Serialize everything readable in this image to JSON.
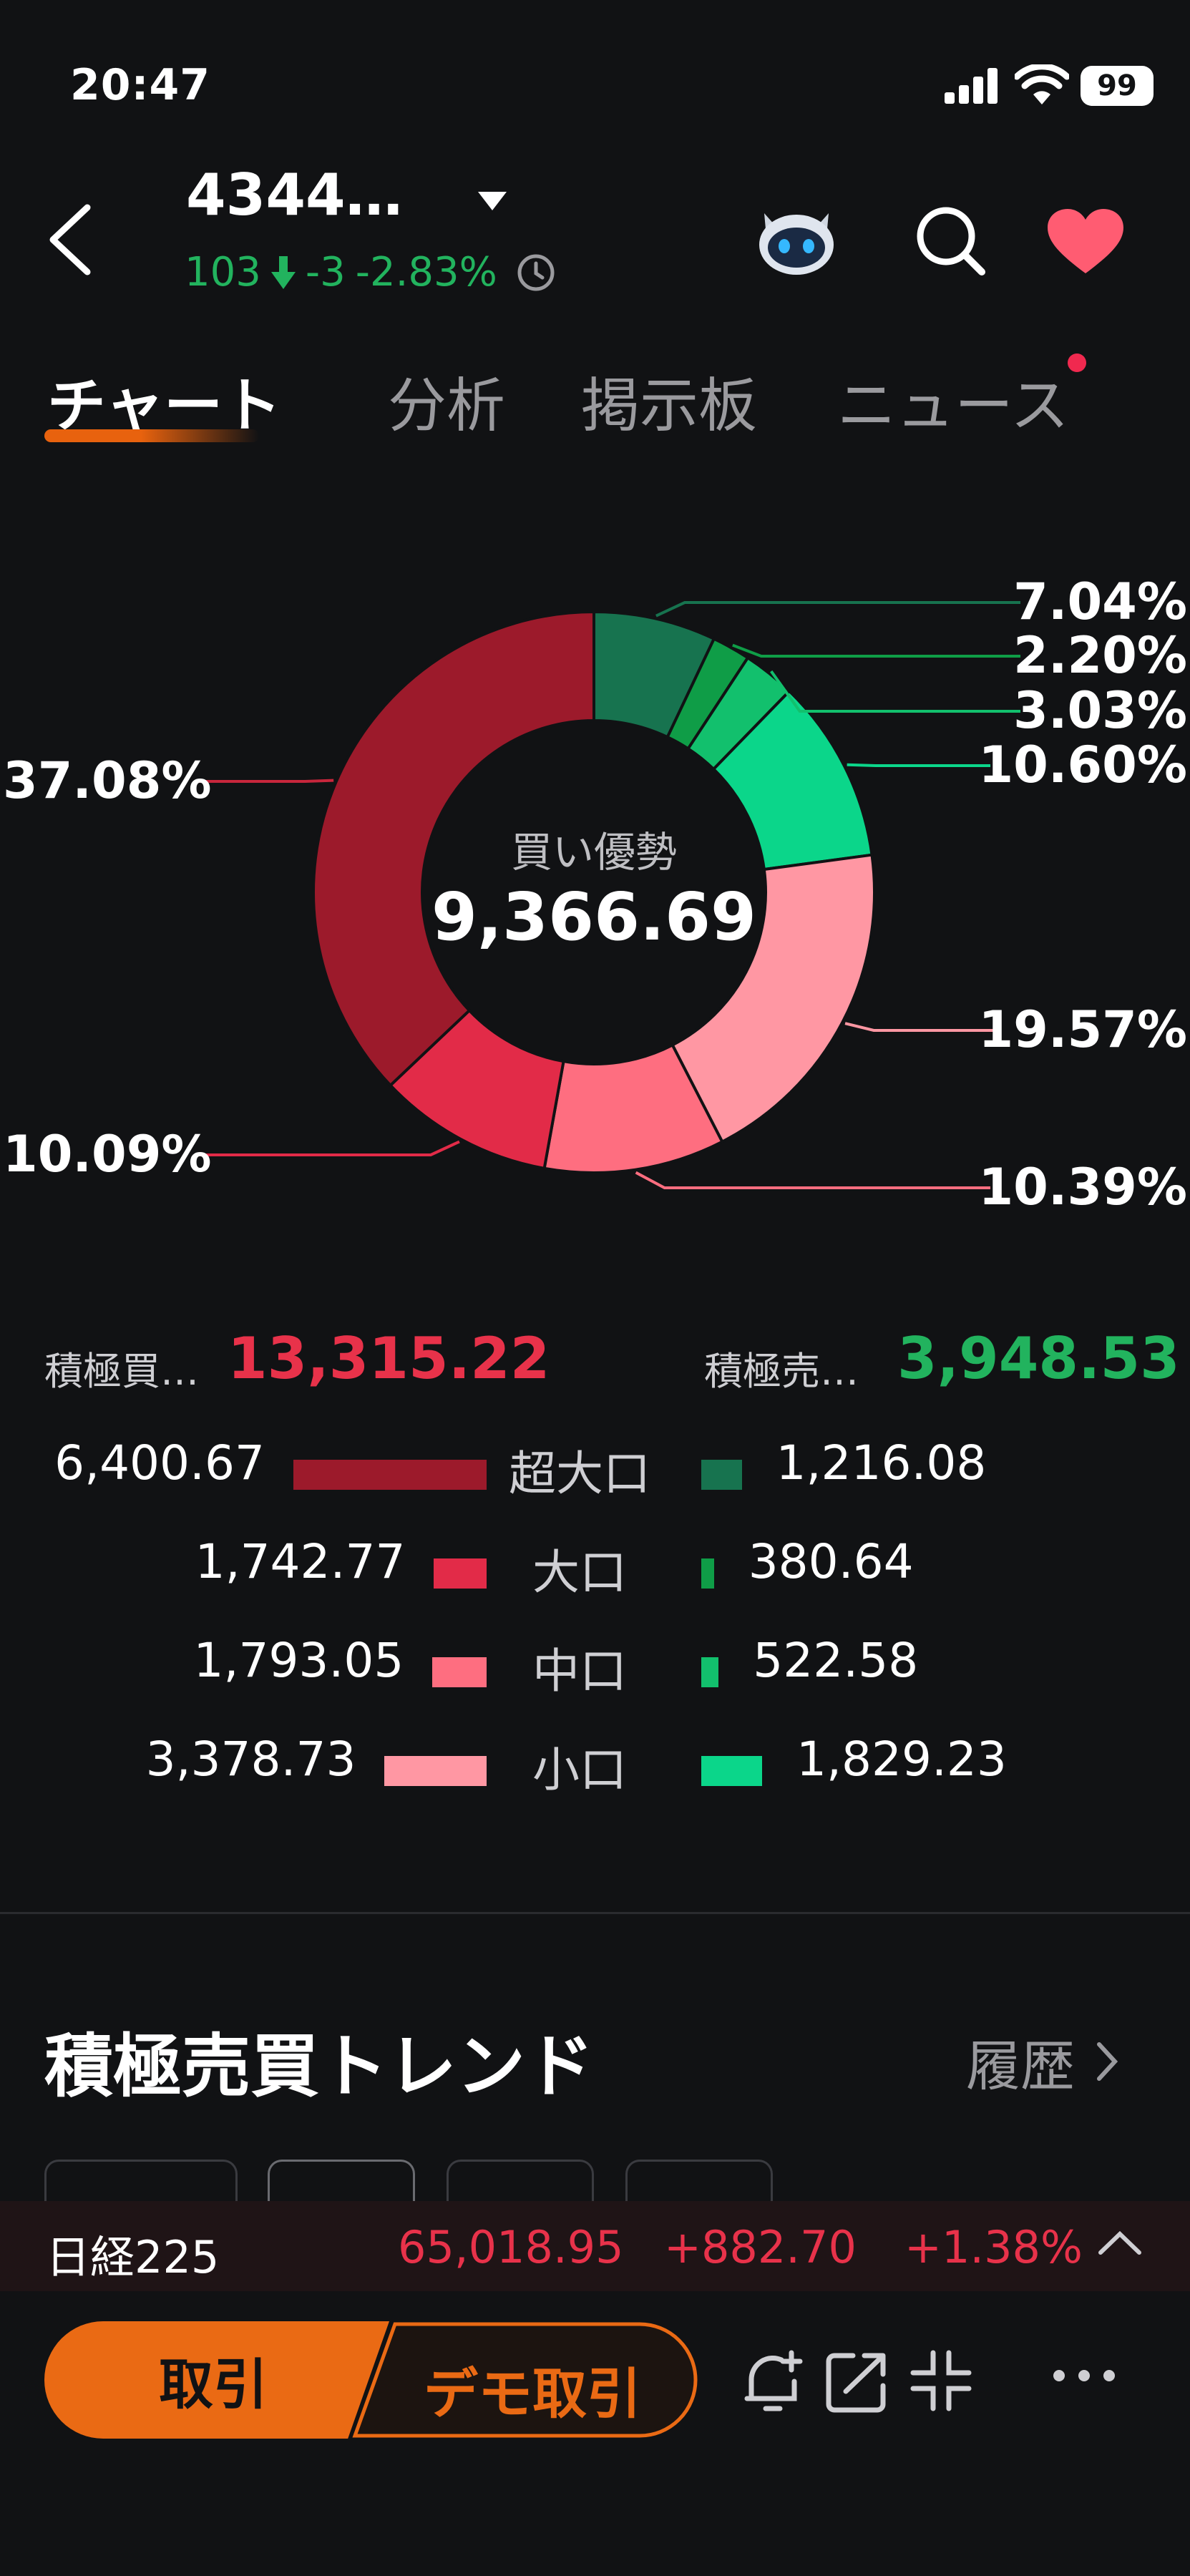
{
  "status_bar": {
    "time": "20:47",
    "battery": "99"
  },
  "header": {
    "ticker": "4344…",
    "price": "103",
    "change": "-3",
    "change_pct": "-2.83%"
  },
  "tabs": [
    {
      "label": "チャート",
      "active": true
    },
    {
      "label": "分析"
    },
    {
      "label": "掲示板"
    },
    {
      "label": "ニュース"
    }
  ],
  "donut": {
    "center_label": "買い優勢",
    "center_value": "9,366.69",
    "segments": [
      {
        "label": "7.04%",
        "pct": 7.04,
        "color": "#17734f"
      },
      {
        "label": "2.20%",
        "pct": 2.2,
        "color": "#0f9d47"
      },
      {
        "label": "3.03%",
        "pct": 3.03,
        "color": "#12c06d"
      },
      {
        "label": "10.60%",
        "pct": 10.6,
        "color": "#0bd68a"
      },
      {
        "label": "19.57%",
        "pct": 19.57,
        "color": "#ff97a3"
      },
      {
        "label": "10.39%",
        "pct": 10.39,
        "color": "#fe6e80"
      },
      {
        "label": "10.09%",
        "pct": 10.09,
        "color": "#e22b48"
      },
      {
        "label": "37.08%",
        "pct": 37.08,
        "color": "#9c1a2b"
      }
    ]
  },
  "summary": {
    "buy_label": "積極買…",
    "buy_total": "13,315.22",
    "sell_label": "積極売…",
    "sell_total": "3,948.53"
  },
  "breakdown": [
    {
      "category": "超大口",
      "buy": "6,400.67",
      "buy_amount": 6400.67,
      "sell": "1,216.08",
      "sell_amount": 1216.08,
      "buy_color": "#9c1a2b",
      "sell_color": "#17734f"
    },
    {
      "category": "大口",
      "buy": "1,742.77",
      "buy_amount": 1742.77,
      "sell": "380.64",
      "sell_amount": 380.64,
      "buy_color": "#e22b48",
      "sell_color": "#0f9d47"
    },
    {
      "category": "中口",
      "buy": "1,793.05",
      "buy_amount": 1793.05,
      "sell": "522.58",
      "sell_amount": 522.58,
      "buy_color": "#fe6e80",
      "sell_color": "#12c06d"
    },
    {
      "category": "小口",
      "buy": "3,378.73",
      "buy_amount": 3378.73,
      "sell": "1,829.23",
      "sell_amount": 1829.23,
      "buy_color": "#ff97a3",
      "sell_color": "#0bd68a"
    }
  ],
  "trend": {
    "title": "積極売買トレンド",
    "history_label": "履歴"
  },
  "index_ticker": {
    "name": "日経225",
    "value": "65,018.95",
    "change": "+882.70",
    "change_pct": "+1.38%"
  },
  "bottom_bar": {
    "trade_label": "取引",
    "demo_trade_label": "デモ取引"
  },
  "colors": {
    "accent": "#ea6a14",
    "up": "#e8324a",
    "down": "#22b35e"
  }
}
